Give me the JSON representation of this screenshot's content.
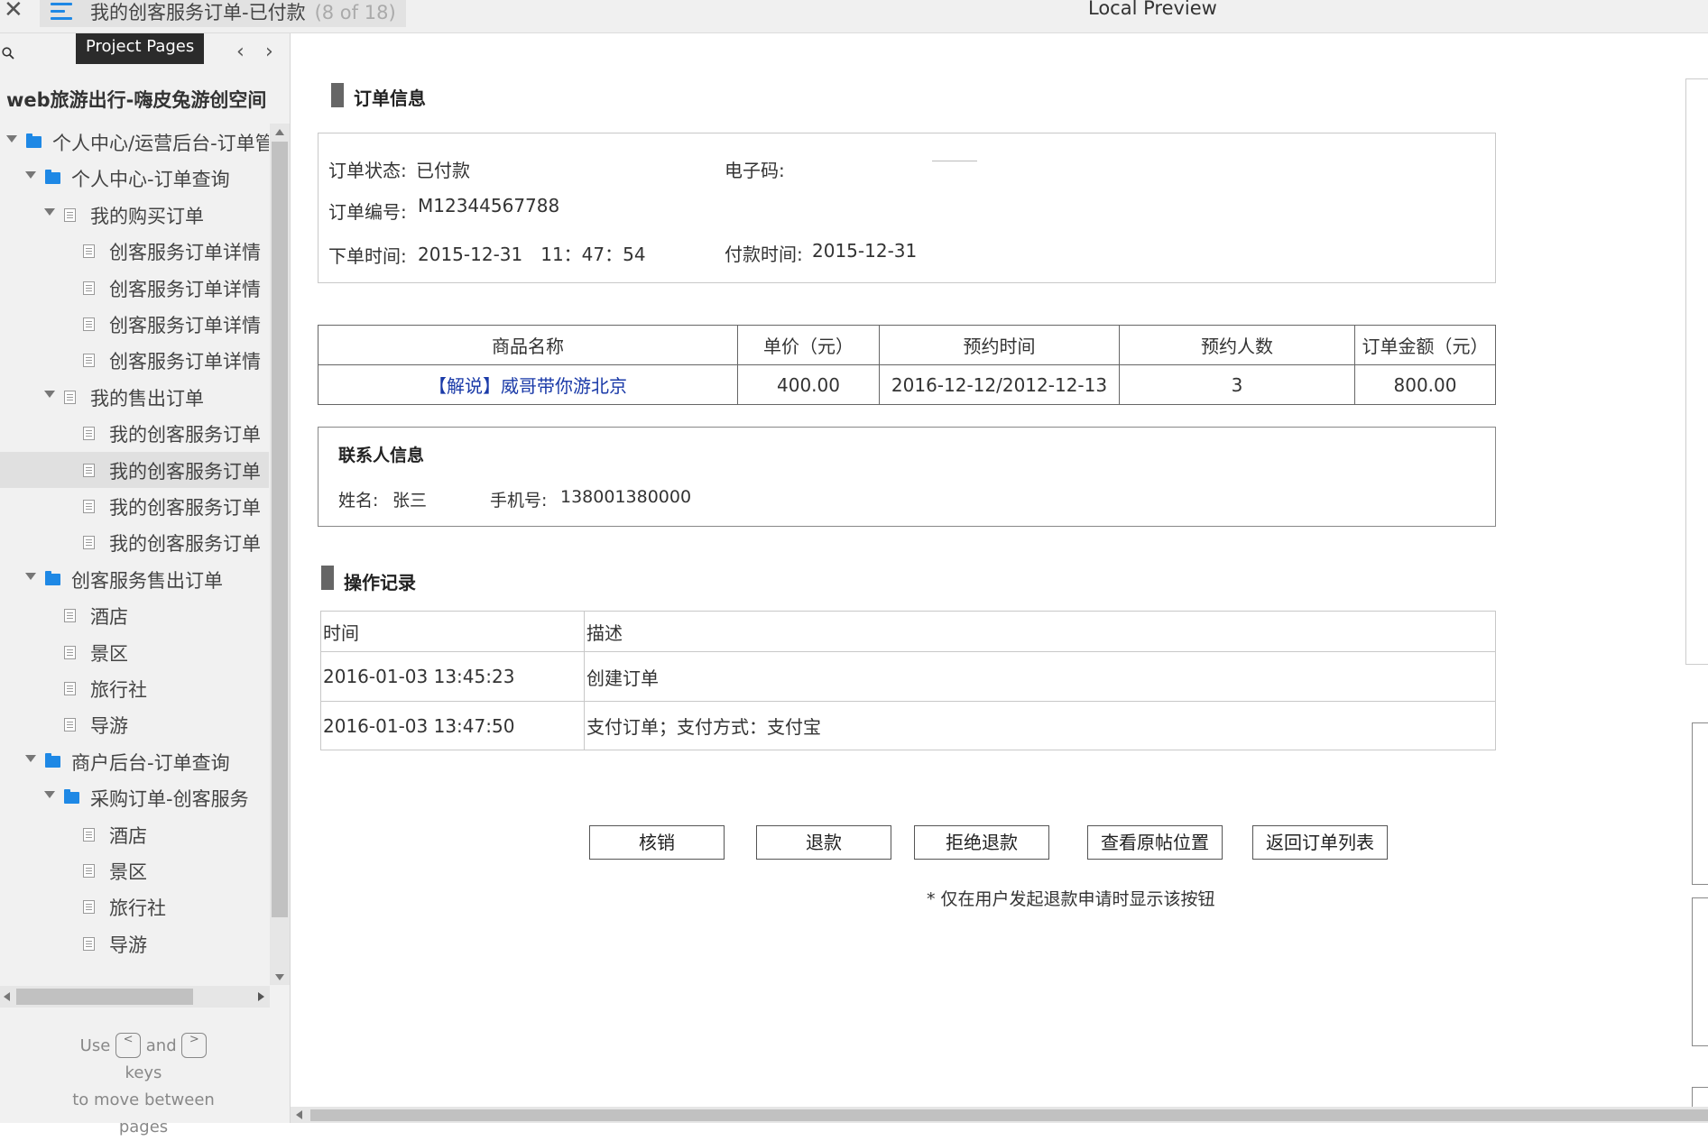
{
  "topbar": {
    "close_symbol": "✕",
    "page_title": "我的创客服务订单-已付款",
    "page_count": "(8 of 18)",
    "preview_title": "Local Preview"
  },
  "sidebar": {
    "tooltip": "Project Pages",
    "project_name": "web旅游出行-嗨皮兔游创空间",
    "tree": [
      {
        "label": "个人中心/运营后台-订单管",
        "type": "folder",
        "level": 0,
        "expanded": true
      },
      {
        "label": "个人中心-订单查询",
        "type": "folder",
        "level": 1,
        "expanded": true
      },
      {
        "label": "我的购买订单",
        "type": "page",
        "level": 2,
        "expanded": true
      },
      {
        "label": "创客服务订单详情",
        "type": "page",
        "level": 3
      },
      {
        "label": "创客服务订单详情",
        "type": "page",
        "level": 3
      },
      {
        "label": "创客服务订单详情",
        "type": "page",
        "level": 3
      },
      {
        "label": "创客服务订单详情",
        "type": "page",
        "level": 3
      },
      {
        "label": "我的售出订单",
        "type": "page",
        "level": 2,
        "expanded": true
      },
      {
        "label": "我的创客服务订单",
        "type": "page",
        "level": 3
      },
      {
        "label": "我的创客服务订单",
        "type": "page",
        "level": 3,
        "selected": true
      },
      {
        "label": "我的创客服务订单",
        "type": "page",
        "level": 3
      },
      {
        "label": "我的创客服务订单",
        "type": "page",
        "level": 3
      },
      {
        "label": "创客服务售出订单",
        "type": "folder",
        "level": 1,
        "expanded": true
      },
      {
        "label": "酒店",
        "type": "page",
        "level": 2
      },
      {
        "label": "景区",
        "type": "page",
        "level": 2
      },
      {
        "label": "旅行社",
        "type": "page",
        "level": 2
      },
      {
        "label": "导游",
        "type": "page",
        "level": 2
      },
      {
        "label": "商户后台-订单查询",
        "type": "folder",
        "level": 1,
        "expanded": true
      },
      {
        "label": "采购订单-创客服务",
        "type": "folder",
        "level": 2,
        "expanded": true
      },
      {
        "label": "酒店",
        "type": "page",
        "level": 3
      },
      {
        "label": "景区",
        "type": "page",
        "level": 3
      },
      {
        "label": "旅行社",
        "type": "page",
        "level": 3
      },
      {
        "label": "导游",
        "type": "page",
        "level": 3
      }
    ],
    "hint": {
      "use": "Use",
      "key_prev": "<",
      "and": "and",
      "key_next": ">",
      "keys": "keys",
      "line2": "to move between",
      "line3": "pages"
    }
  },
  "order_info": {
    "title": "订单信息",
    "status_label": "订单状态:",
    "status_value": "已付款",
    "code_label": "电子码:",
    "number_label": "订单编号:",
    "number_value": "M12344567788",
    "order_time_label": "下单时间:",
    "order_time_value": "2015-12-31　11：47：54",
    "pay_time_label": "付款时间:",
    "pay_time_value": "2015-12-31"
  },
  "goods_table": {
    "headers": [
      "商品名称",
      "单价（元）",
      "预约时间",
      "预约人数",
      "订单金额（元）"
    ],
    "row": {
      "name": "【解说】威哥带你游北京",
      "price": "400.00",
      "date": "2016-12-12/2012-12-13",
      "people": "3",
      "amount": "800.00"
    }
  },
  "contact": {
    "title": "联系人信息",
    "name_label": "姓名:",
    "name_value": "张三",
    "phone_label": "手机号:",
    "phone_value": "138001380000"
  },
  "log": {
    "title": "操作记录",
    "headers": [
      "时间",
      "描述"
    ],
    "rows": [
      {
        "time": "2016-01-03  13:45:23",
        "desc": "创建订单"
      },
      {
        "time": "2016-01-03  13:47:50",
        "desc": "支付订单；支付方式：支付宝"
      }
    ]
  },
  "buttons": {
    "verify": "核销",
    "refund": "退款",
    "reject_refund": "拒绝退款",
    "view_post": "查看原帖位置",
    "back_list": "返回订单列表"
  },
  "note": "* 仅在用户发起退款申请时显示该按钮",
  "colors": {
    "accent_blue": "#1e88e5",
    "link_blue": "#1a3aa8",
    "section_bar": "#666666"
  }
}
